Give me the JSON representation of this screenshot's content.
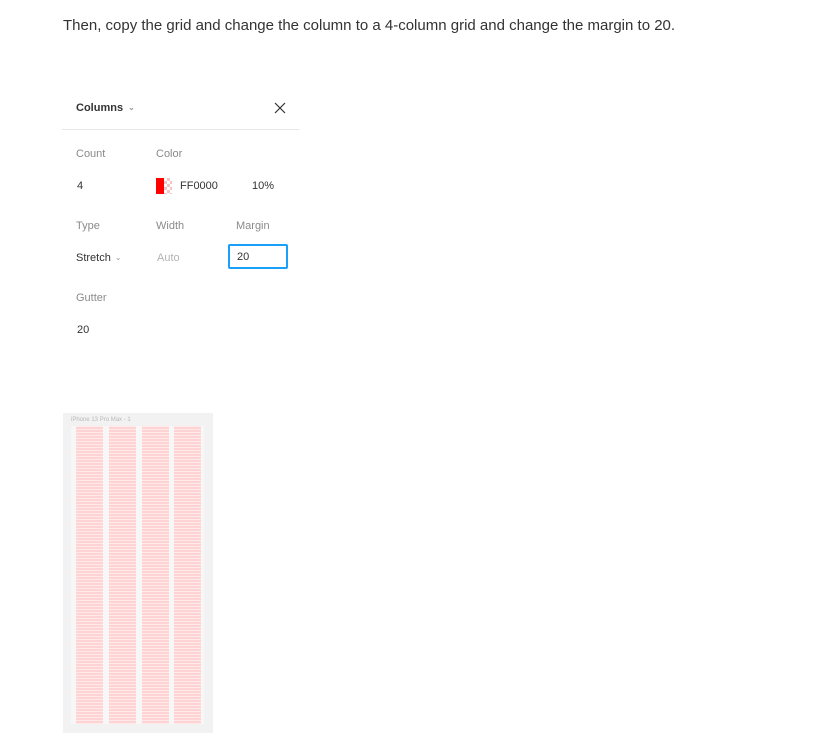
{
  "instruction": "Then, copy the grid and change the column to a 4-column grid and change the margin to 20.",
  "panel": {
    "title": "Columns",
    "title_chevron": "⌄",
    "close_icon": "close-icon",
    "count": {
      "label": "Count",
      "value": "4"
    },
    "color": {
      "label": "Color",
      "hex": "FF0000",
      "opacity": "10%",
      "swatch_color": "#FF0000"
    },
    "type": {
      "label": "Type",
      "value": "Stretch",
      "chevron": "⌄"
    },
    "width": {
      "label": "Width",
      "value": "Auto"
    },
    "margin": {
      "label": "Margin",
      "value": "20"
    },
    "gutter": {
      "label": "Gutter",
      "value": "20"
    }
  },
  "preview": {
    "frame_label": "iPhone 13 Pro Max - 1",
    "column_count": 4,
    "column_color": "#FFD3D3"
  }
}
